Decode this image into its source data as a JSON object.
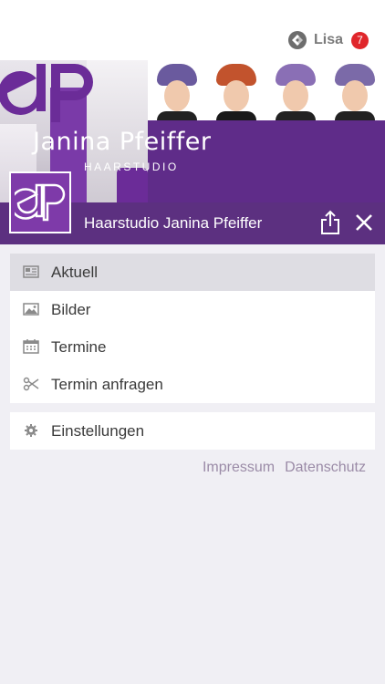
{
  "user": {
    "name": "Lisa",
    "badge_count": "7",
    "icon": "app-logo-icon"
  },
  "header": {
    "brand_name": "Janina Pfeiffer",
    "brand_sub": "HAARSTUDIO",
    "title": "Haarstudio Janina Pfeiffer",
    "share_icon": "share-icon",
    "close_icon": "close-icon"
  },
  "menu": {
    "items": [
      {
        "label": "Aktuell",
        "icon": "news-icon",
        "active": true
      },
      {
        "label": "Bilder",
        "icon": "image-icon",
        "active": false
      },
      {
        "label": "Termine",
        "icon": "calendar-icon",
        "active": false
      },
      {
        "label": "Termin anfragen",
        "icon": "scissors-icon",
        "active": false
      }
    ],
    "settings": {
      "label": "Einstellungen",
      "icon": "gear-icon"
    }
  },
  "footer": {
    "impressum": "Impressum",
    "datenschutz": "Datenschutz"
  },
  "colors": {
    "brand_purple": "#5f2c89",
    "badge_red": "#e0262b",
    "link_color": "#9b8ba7"
  }
}
